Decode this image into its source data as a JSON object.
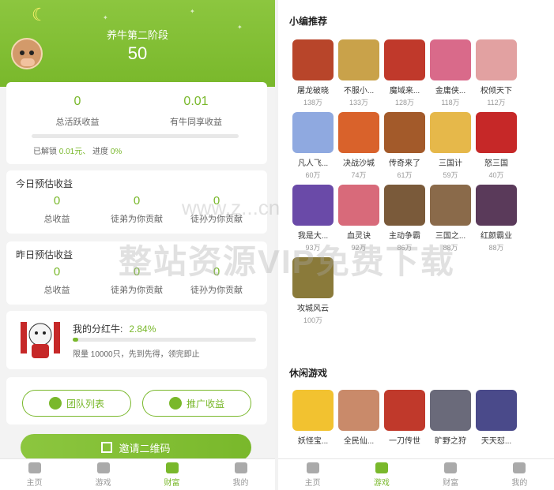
{
  "left": {
    "stage_label": "养牛第二阶段",
    "stage_value": "50",
    "active_income": {
      "value": "0",
      "label": "总活跃收益"
    },
    "shared_income": {
      "value": "0.01",
      "label": "有牛同享收益"
    },
    "unlock": {
      "prefix": "已解锁",
      "amount": "0.01元、",
      "progress_label": "进度",
      "progress": "0%"
    },
    "today": {
      "title": "今日预估收益",
      "items": [
        {
          "value": "0",
          "label": "总收益"
        },
        {
          "value": "0",
          "label": "徒弟为你贡献"
        },
        {
          "value": "0",
          "label": "徒孙为你贡献"
        }
      ]
    },
    "yesterday": {
      "title": "昨日预估收益",
      "items": [
        {
          "value": "0",
          "label": "总收益"
        },
        {
          "value": "0",
          "label": "徒弟为你贡献"
        },
        {
          "value": "0",
          "label": "徒孙为你贡献"
        }
      ]
    },
    "dividend": {
      "label": "我的分红牛:",
      "value": "2.84%",
      "progress_fraction": 0.03,
      "note": "限量 10000只，先到先得，领完即止"
    },
    "team_button": "团队列表",
    "promo_button": "推广收益",
    "qr_button": "邀请二维码",
    "tabs": [
      {
        "label": "主页"
      },
      {
        "label": "游戏"
      },
      {
        "label": "财富",
        "active": true
      },
      {
        "label": "我的"
      }
    ]
  },
  "right": {
    "recommend_title": "小编推荐",
    "games": [
      {
        "name": "屠龙破晓",
        "count": "138万",
        "color": "#b8452a"
      },
      {
        "name": "不服小...",
        "count": "133万",
        "color": "#c9a24a"
      },
      {
        "name": "魔域来...",
        "count": "128万",
        "color": "#c0392b"
      },
      {
        "name": "金庸侠...",
        "count": "118万",
        "color": "#d96a8a"
      },
      {
        "name": "权倾天下",
        "count": "112万",
        "color": "#e2a1a1"
      },
      {
        "name": "凡人飞...",
        "count": "60万",
        "color": "#8fa9e0"
      },
      {
        "name": "决战沙城",
        "count": "74万",
        "color": "#d9622b"
      },
      {
        "name": "传奇来了",
        "count": "61万",
        "color": "#a35a2a"
      },
      {
        "name": "三国计",
        "count": "59万",
        "color": "#e6b84a"
      },
      {
        "name": "怒三国",
        "count": "40万",
        "color": "#c62828"
      },
      {
        "name": "我是大...",
        "count": "93万",
        "color": "#6a4aa8"
      },
      {
        "name": "血灵诀",
        "count": "92万",
        "color": "#d86a7a"
      },
      {
        "name": "主动争霸",
        "count": "86万",
        "color": "#7a5a3a"
      },
      {
        "name": "三国之...",
        "count": "88万",
        "color": "#8a6a4a"
      },
      {
        "name": "红颜霸业",
        "count": "88万",
        "color": "#5a3a5a"
      },
      {
        "name": "攻城风云",
        "count": "100万",
        "color": "#8a7a3a"
      }
    ],
    "casual_title": "休闲游戏",
    "casual": [
      {
        "name": "妖怪宝...",
        "color": "#f2c230"
      },
      {
        "name": "全民仙...",
        "color": "#c98a6a"
      },
      {
        "name": "一刀传世",
        "color": "#c0392b"
      },
      {
        "name": "旷野之狩",
        "color": "#6a6a7a"
      },
      {
        "name": "天天怼...",
        "color": "#4a4a8a"
      }
    ],
    "tabs": [
      {
        "label": "主页"
      },
      {
        "label": "游戏",
        "active": true
      },
      {
        "label": "财富"
      },
      {
        "label": "我的"
      }
    ]
  },
  "watermark": {
    "text": "整站资源VIP免费下载",
    "url": "www.z...cn"
  }
}
